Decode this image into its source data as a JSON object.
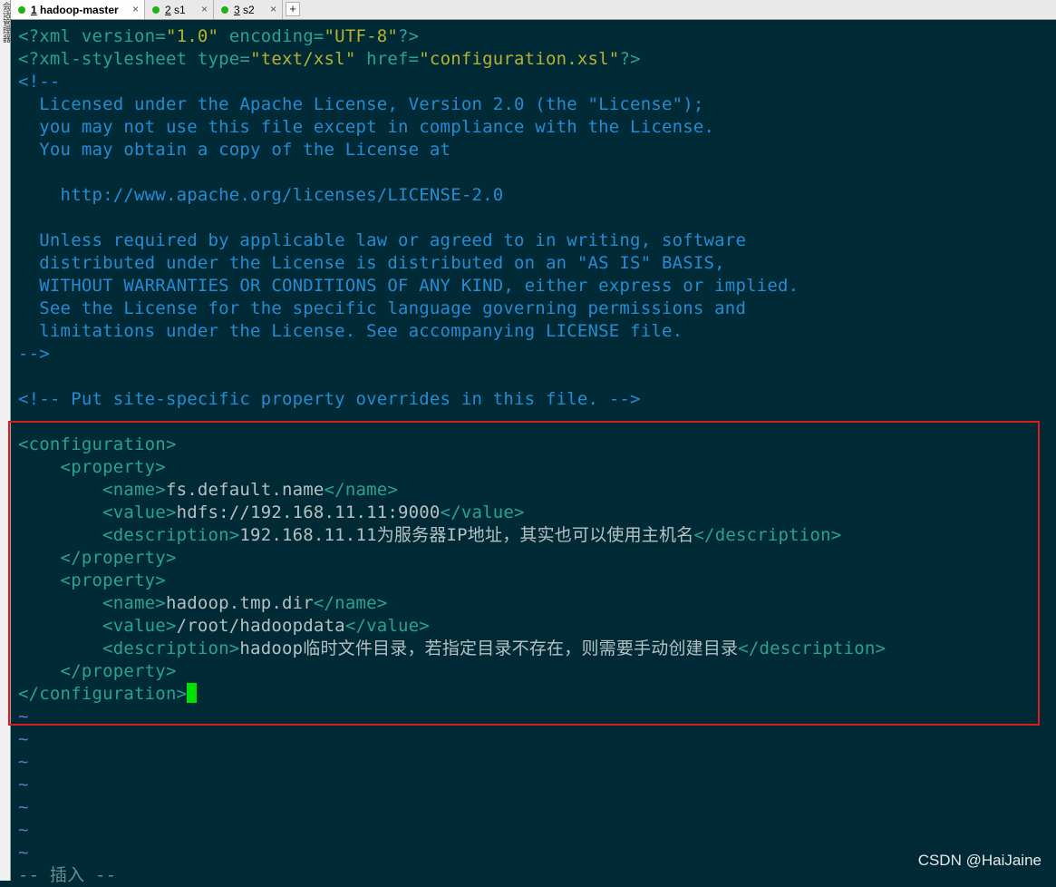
{
  "side_strip": {
    "label": "会话管理器"
  },
  "tabs": [
    {
      "number": "1",
      "name": "hadoop-master",
      "active": true
    },
    {
      "number": "2",
      "name": "s1",
      "active": false
    },
    {
      "number": "3",
      "name": "s2",
      "active": false
    }
  ],
  "tab_add_label": "+",
  "tab_close_label": "×",
  "editor": {
    "lines": [
      {
        "segments": [
          {
            "t": "<?xml version=",
            "c": "tag"
          },
          {
            "t": "\"1.0\"",
            "c": "str"
          },
          {
            "t": " encoding=",
            "c": "tag"
          },
          {
            "t": "\"UTF-8\"",
            "c": "str"
          },
          {
            "t": "?>",
            "c": "tag"
          }
        ]
      },
      {
        "segments": [
          {
            "t": "<?xml-stylesheet type=",
            "c": "tag"
          },
          {
            "t": "\"text/xsl\"",
            "c": "str"
          },
          {
            "t": " href=",
            "c": "tag"
          },
          {
            "t": "\"configuration.xsl\"",
            "c": "str"
          },
          {
            "t": "?>",
            "c": "tag"
          }
        ]
      },
      {
        "segments": [
          {
            "t": "<!--",
            "c": "com"
          }
        ]
      },
      {
        "segments": [
          {
            "t": "  Licensed under the Apache License, Version 2.0 (the \"License\");",
            "c": "com"
          }
        ]
      },
      {
        "segments": [
          {
            "t": "  you may not use this file except in compliance with the License.",
            "c": "com"
          }
        ]
      },
      {
        "segments": [
          {
            "t": "  You may obtain a copy of the License at",
            "c": "com"
          }
        ]
      },
      {
        "segments": [
          {
            "t": "",
            "c": "com"
          }
        ]
      },
      {
        "segments": [
          {
            "t": "    http://www.apache.org/licenses/LICENSE-2.0",
            "c": "com"
          }
        ]
      },
      {
        "segments": [
          {
            "t": "",
            "c": "com"
          }
        ]
      },
      {
        "segments": [
          {
            "t": "  Unless required by applicable law or agreed to in writing, software",
            "c": "com"
          }
        ]
      },
      {
        "segments": [
          {
            "t": "  distributed under the License is distributed on an \"AS IS\" BASIS,",
            "c": "com"
          }
        ]
      },
      {
        "segments": [
          {
            "t": "  WITHOUT WARRANTIES OR CONDITIONS OF ANY KIND, either express or implied.",
            "c": "com"
          }
        ]
      },
      {
        "segments": [
          {
            "t": "  See the License for the specific language governing permissions and",
            "c": "com"
          }
        ]
      },
      {
        "segments": [
          {
            "t": "  limitations under the License. See accompanying LICENSE file.",
            "c": "com"
          }
        ]
      },
      {
        "segments": [
          {
            "t": "-->",
            "c": "com"
          }
        ]
      },
      {
        "segments": [
          {
            "t": "",
            "c": "com"
          }
        ]
      },
      {
        "segments": [
          {
            "t": "<!-- Put site-specific property overrides in this file. -->",
            "c": "com"
          }
        ]
      },
      {
        "segments": [
          {
            "t": "",
            "c": "com"
          }
        ]
      },
      {
        "segments": [
          {
            "t": "<configuration>",
            "c": "tag"
          }
        ]
      },
      {
        "segments": [
          {
            "t": "    <property>",
            "c": "tag"
          }
        ]
      },
      {
        "segments": [
          {
            "t": "        <name>",
            "c": "tag"
          },
          {
            "t": "fs.default.name",
            "c": "txt"
          },
          {
            "t": "</name>",
            "c": "tag"
          }
        ]
      },
      {
        "segments": [
          {
            "t": "        <value>",
            "c": "tag"
          },
          {
            "t": "hdfs://192.168.11.11:9000",
            "c": "txt"
          },
          {
            "t": "</value>",
            "c": "tag"
          }
        ]
      },
      {
        "segments": [
          {
            "t": "        <description>",
            "c": "tag"
          },
          {
            "t": "192.168.11.11为服务器IP地址，其实也可以使用主机名",
            "c": "txt"
          },
          {
            "t": "</description>",
            "c": "tag"
          }
        ]
      },
      {
        "segments": [
          {
            "t": "    </property>",
            "c": "tag"
          }
        ]
      },
      {
        "segments": [
          {
            "t": "    <property>",
            "c": "tag"
          }
        ]
      },
      {
        "segments": [
          {
            "t": "        <name>",
            "c": "tag"
          },
          {
            "t": "hadoop.tmp.dir",
            "c": "txt"
          },
          {
            "t": "</name>",
            "c": "tag"
          }
        ]
      },
      {
        "segments": [
          {
            "t": "        <value>",
            "c": "tag"
          },
          {
            "t": "/root/hadoopdata",
            "c": "txt"
          },
          {
            "t": "</value>",
            "c": "tag"
          }
        ]
      },
      {
        "segments": [
          {
            "t": "        <description>",
            "c": "tag"
          },
          {
            "t": "hadoop临时文件目录，若指定目录不存在，则需要手动创建目录",
            "c": "txt"
          },
          {
            "t": "</description>",
            "c": "tag"
          }
        ]
      },
      {
        "segments": [
          {
            "t": "    </property>",
            "c": "tag"
          }
        ]
      },
      {
        "segments": [
          {
            "t": "</configuration>",
            "c": "tag"
          }
        ],
        "cursor": true
      },
      {
        "segments": [
          {
            "t": "~",
            "c": "tilde"
          }
        ]
      },
      {
        "segments": [
          {
            "t": "~",
            "c": "tilde"
          }
        ]
      },
      {
        "segments": [
          {
            "t": "~",
            "c": "tilde"
          }
        ]
      },
      {
        "segments": [
          {
            "t": "~",
            "c": "tilde"
          }
        ]
      },
      {
        "segments": [
          {
            "t": "~",
            "c": "tilde"
          }
        ]
      },
      {
        "segments": [
          {
            "t": "~",
            "c": "tilde"
          }
        ]
      },
      {
        "segments": [
          {
            "t": "~",
            "c": "tilde"
          }
        ]
      },
      {
        "segments": [
          {
            "t": "-- 插入 --",
            "c": "mode"
          }
        ]
      }
    ]
  },
  "watermark": "CSDN @HaiJaine"
}
